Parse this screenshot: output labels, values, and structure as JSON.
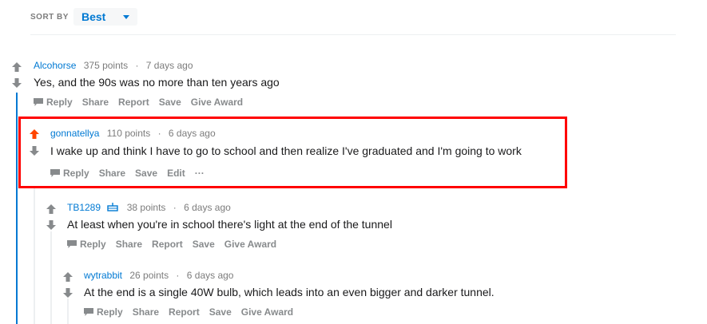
{
  "sort": {
    "label": "SORT BY",
    "value": "Best"
  },
  "comments": [
    {
      "author": "Alcohorse",
      "points": "375 points",
      "time": "7 days ago",
      "text": "Yes, and the 90s was no more than ten years ago",
      "actions": [
        "Reply",
        "Share",
        "Report",
        "Save",
        "Give Award"
      ]
    },
    {
      "author": "gonnatellya",
      "points": "110 points",
      "time": "6 days ago",
      "text": "I wake up and think I have to go to school and then realize I've graduated and I'm going to work",
      "actions": [
        "Reply",
        "Share",
        "Save",
        "Edit",
        "···"
      ],
      "upvoted": true
    },
    {
      "author": "TB1289",
      "points": "38 points",
      "time": "6 days ago",
      "text": "At least when you're in school there's light at the end of the tunnel",
      "actions": [
        "Reply",
        "Share",
        "Report",
        "Save",
        "Give Award"
      ]
    },
    {
      "author": "wytrabbit",
      "points": "26 points",
      "time": "6 days ago",
      "text": "At the end is a single 40W bulb, which leads into an even bigger and darker tunnel.",
      "actions": [
        "Reply",
        "Share",
        "Report",
        "Save",
        "Give Award"
      ]
    }
  ],
  "colors": {
    "accent": "#0079d3",
    "upvote": "#ff4500",
    "highlight": "#ff0000",
    "muted": "#878a8c"
  }
}
